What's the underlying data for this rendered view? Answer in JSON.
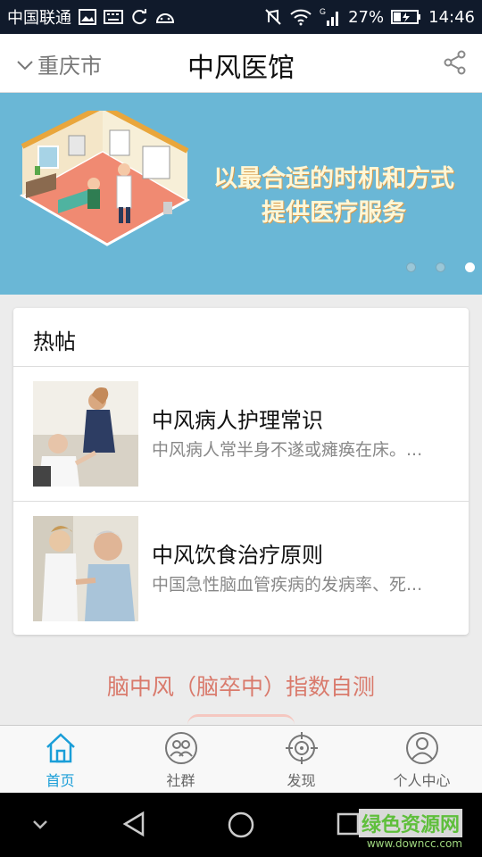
{
  "status_bar": {
    "carrier": "中国联通",
    "battery": "27%",
    "time": "14:46",
    "signal_label": "G"
  },
  "header": {
    "city": "重庆市",
    "title": "中风医馆"
  },
  "banner": {
    "line1": "以最合适的时机和方式",
    "line2": "提供医疗服务",
    "slide_count": 3,
    "active_slide": 3
  },
  "hot_posts": {
    "heading": "热帖",
    "items": [
      {
        "title": "中风病人护理常识",
        "summary": "中风病人常半身不遂或瘫痪在床。..."
      },
      {
        "title": "中风饮食治疗原则",
        "summary": "中国急性脑血管疾病的发病率、死..."
      }
    ]
  },
  "self_test": {
    "label": "脑中风（脑卒中）指数自测"
  },
  "tabs": [
    {
      "label": "首页",
      "icon": "home-icon",
      "active": true
    },
    {
      "label": "社群",
      "icon": "community-icon",
      "active": false
    },
    {
      "label": "发现",
      "icon": "discover-icon",
      "active": false
    },
    {
      "label": "个人中心",
      "icon": "profile-icon",
      "active": false
    }
  ],
  "watermark": {
    "title": "绿色资源网",
    "url": "www.downcc.com"
  },
  "colors": {
    "accent": "#1a9ed8",
    "banner_bg": "#6ab7d6",
    "self_test": "#d97a6c"
  }
}
